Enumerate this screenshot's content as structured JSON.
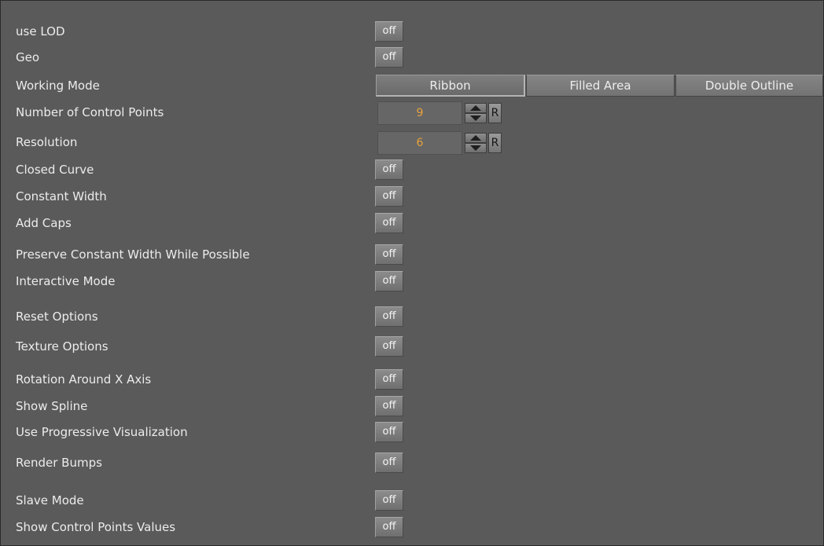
{
  "rows": {
    "use_lod": {
      "label": "use LOD",
      "value": "off"
    },
    "geo": {
      "label": "Geo",
      "value": "off"
    },
    "working_mode": {
      "label": "Working Mode",
      "options": [
        "Ribbon",
        "Filled Area",
        "Double Outline"
      ],
      "selected": "Ribbon"
    },
    "control_points": {
      "label": "Number of Control Points",
      "value": "9",
      "reset_label": "R"
    },
    "resolution": {
      "label": "Resolution",
      "value": "6",
      "reset_label": "R"
    },
    "closed_curve": {
      "label": "Closed Curve",
      "value": "off"
    },
    "constant_width": {
      "label": "Constant Width",
      "value": "off"
    },
    "add_caps": {
      "label": "Add Caps",
      "value": "off"
    },
    "preserve_constant_width": {
      "label": "Preserve Constant Width While Possible",
      "value": "off"
    },
    "interactive_mode": {
      "label": "Interactive Mode",
      "value": "off"
    },
    "reset_options": {
      "label": "Reset Options",
      "value": "off"
    },
    "texture_options": {
      "label": "Texture Options",
      "value": "off"
    },
    "rotation_x_axis": {
      "label": "Rotation Around X Axis",
      "value": "off"
    },
    "show_spline": {
      "label": "Show Spline",
      "value": "off"
    },
    "progressive_visualization": {
      "label": "Use Progressive Visualization",
      "value": "off"
    },
    "render_bumps": {
      "label": "Render Bumps",
      "value": "off"
    },
    "slave_mode": {
      "label": "Slave Mode",
      "value": "off"
    },
    "show_control_points_values": {
      "label": "Show Control Points Values",
      "value": "off"
    }
  },
  "colors": {
    "panel_bg": "#5a5a5a",
    "label_text": "#ececec",
    "numeric_value": "#e8a23c"
  }
}
